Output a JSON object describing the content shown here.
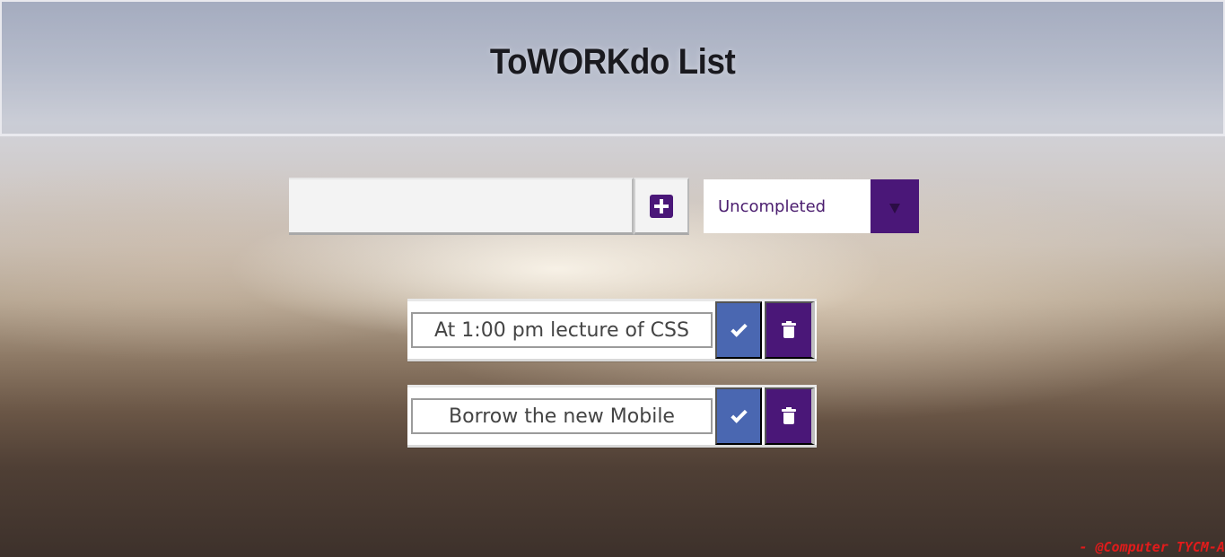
{
  "header": {
    "title": "ToWORKdo List"
  },
  "form": {
    "input_value": "",
    "input_placeholder": "",
    "add_icon": "plus-square-icon",
    "filter_selected": "Uncompleted",
    "filter_arrow_icon": "caret-down-icon"
  },
  "todos": [
    {
      "text": "At 1:00 pm lecture of CSS",
      "complete_icon": "check-icon",
      "delete_icon": "trash-icon"
    },
    {
      "text": "Borrow the new Mobile",
      "complete_icon": "check-icon",
      "delete_icon": "trash-icon"
    }
  ],
  "footer": {
    "credit": "- @Computer TYCM-A"
  },
  "colors": {
    "accent_purple": "#4a1778",
    "check_blue": "#4a67b1",
    "credit_red": "#e21b1b"
  }
}
